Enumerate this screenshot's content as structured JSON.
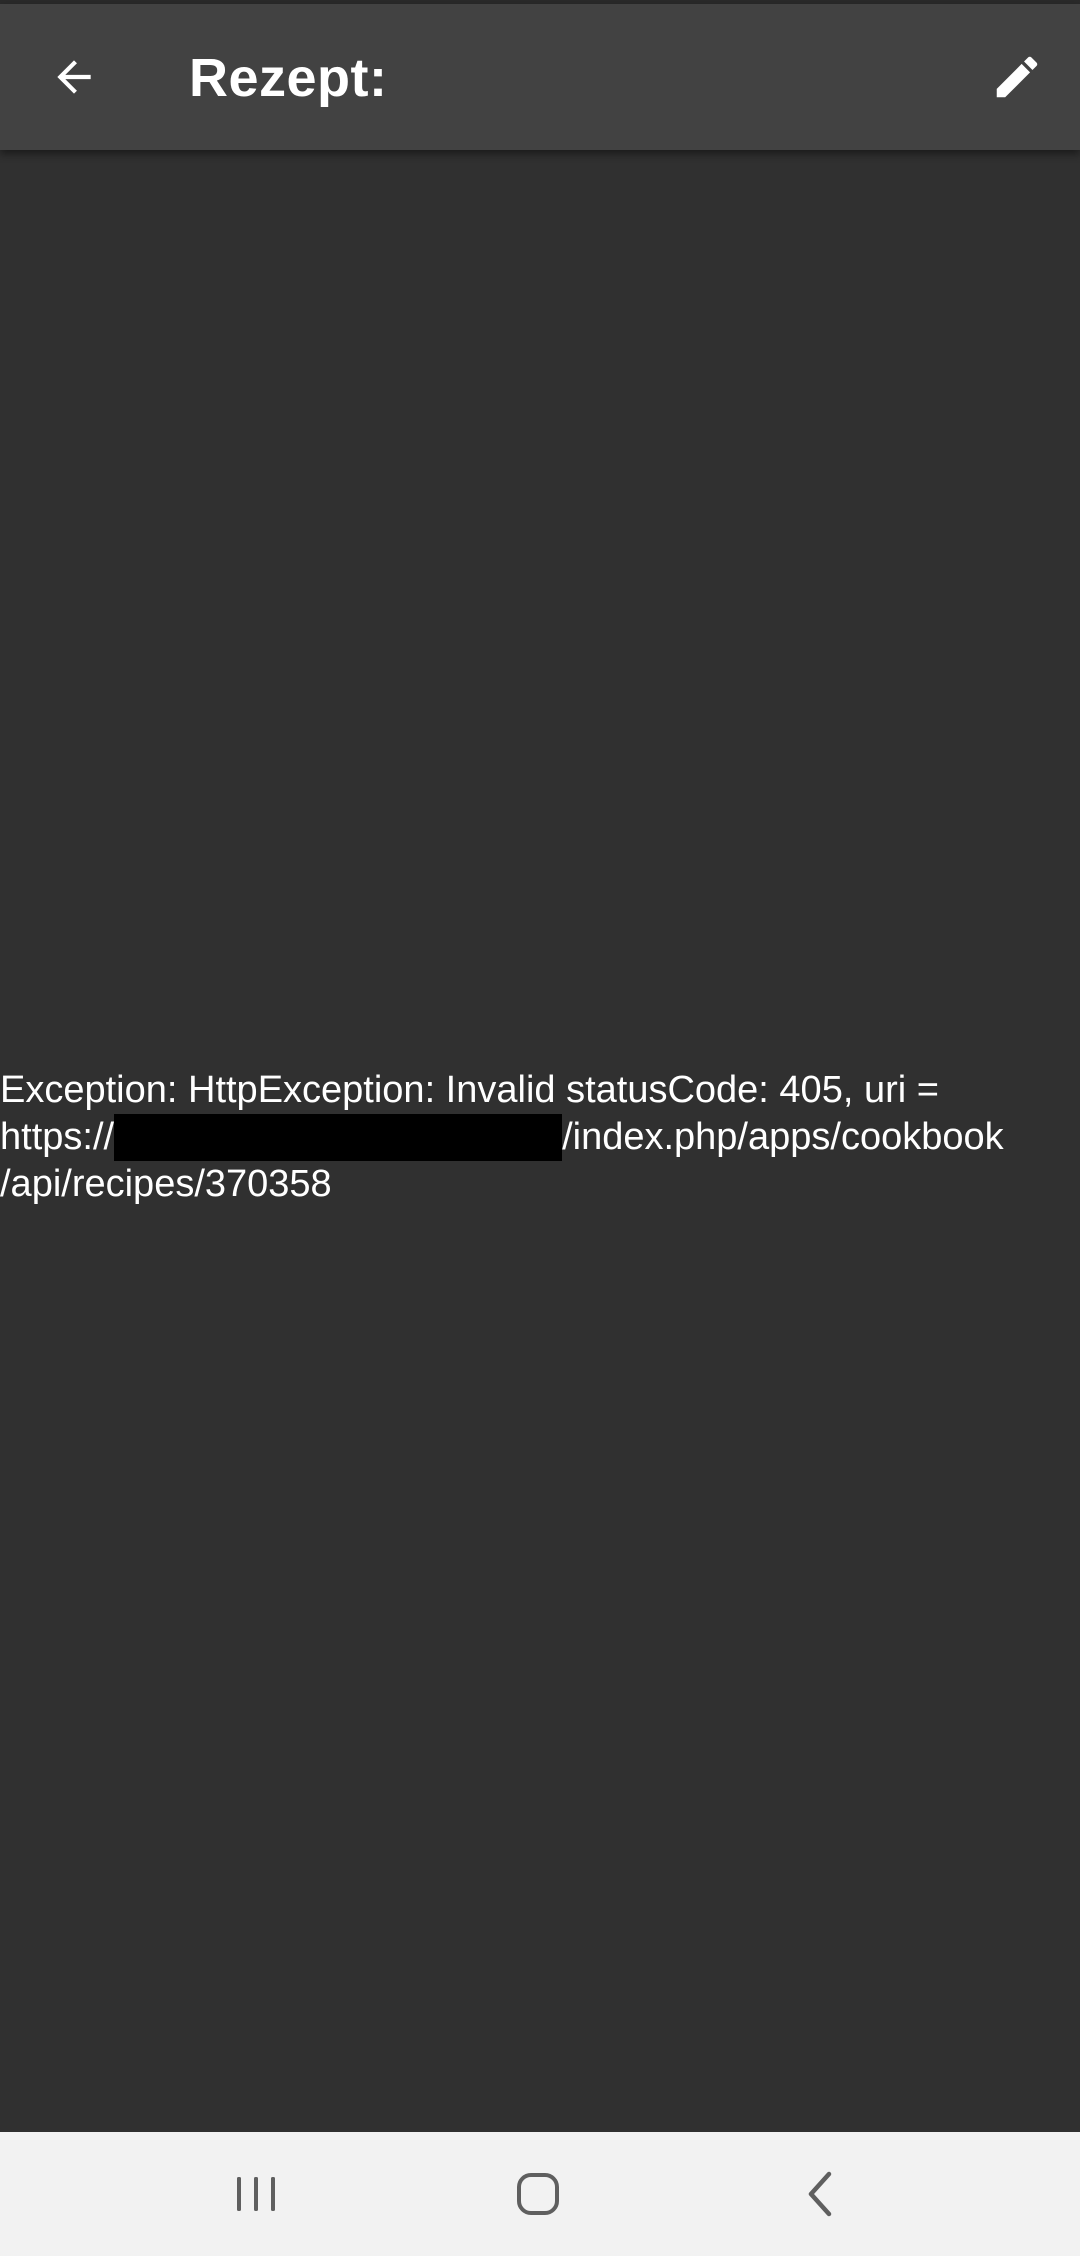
{
  "app_bar": {
    "title": "Rezept:",
    "back_icon": "arrow-back-icon",
    "edit_icon": "pencil-edit-icon",
    "background": "#424242"
  },
  "content": {
    "background": "#303030",
    "error": {
      "line1": "Exception: HttpException: Invalid statusCode: 405, uri =",
      "line2_prefix": "https://",
      "line2_suffix": "/index.php/apps/cookbook",
      "line3": "/api/recipes/370358"
    }
  },
  "nav_bar": {
    "background": "#f2f2f2",
    "icons": [
      "recents-icon",
      "home-icon",
      "back-icon"
    ]
  }
}
